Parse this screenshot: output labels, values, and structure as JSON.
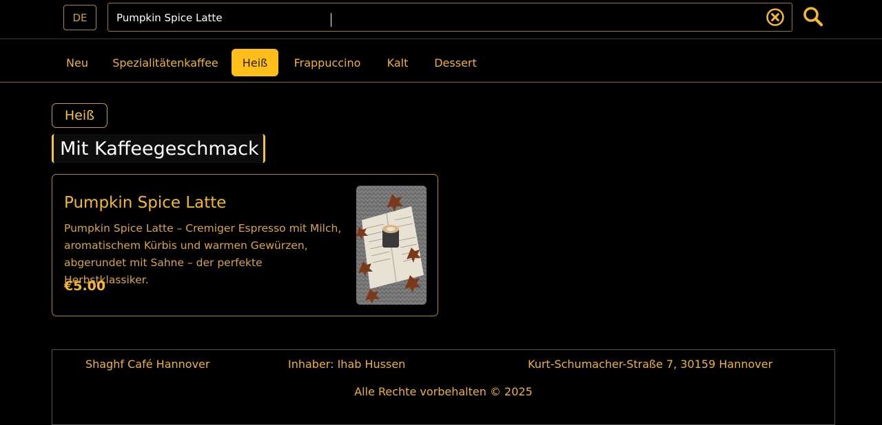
{
  "header": {
    "lang_label": "DE",
    "search_value": "Pumpkin Spice Latte",
    "search_placeholder": "",
    "clear_icon": "clear-circle-icon",
    "search_icon": "search-icon"
  },
  "tabs": [
    {
      "label": "Neu",
      "active": false
    },
    {
      "label": "Spezialitätenkaffee",
      "active": false
    },
    {
      "label": "Heiß",
      "active": true
    },
    {
      "label": "Frappuccino",
      "active": false
    },
    {
      "label": "Kalt",
      "active": false
    },
    {
      "label": "Dessert",
      "active": false
    }
  ],
  "main": {
    "category_pill": "Heiß",
    "subcategory_title": "Mit Kaffeegeschmack",
    "product": {
      "name": "Pumpkin Spice Latte",
      "description": "Pumpkin Spice Latte – Cremiger Espresso mit Milch, aromatischem Kürbis und warmen Gewürzen, abgerundet mit Sahne – der perfekte Herbstklassiker.",
      "price": "€5.00"
    }
  },
  "footer": {
    "name": "Shaghf Café Hannover",
    "owner": "Inhaber: Ihab Hussen",
    "address": "Kurt-Schumacher-Straße 7, 30159 Hannover",
    "copyright": "Alle Rechte vorbehalten © 2025"
  },
  "colors": {
    "accent": "#f5b82e",
    "active_tab_bg": "#ffbe1a",
    "background": "#000000"
  }
}
